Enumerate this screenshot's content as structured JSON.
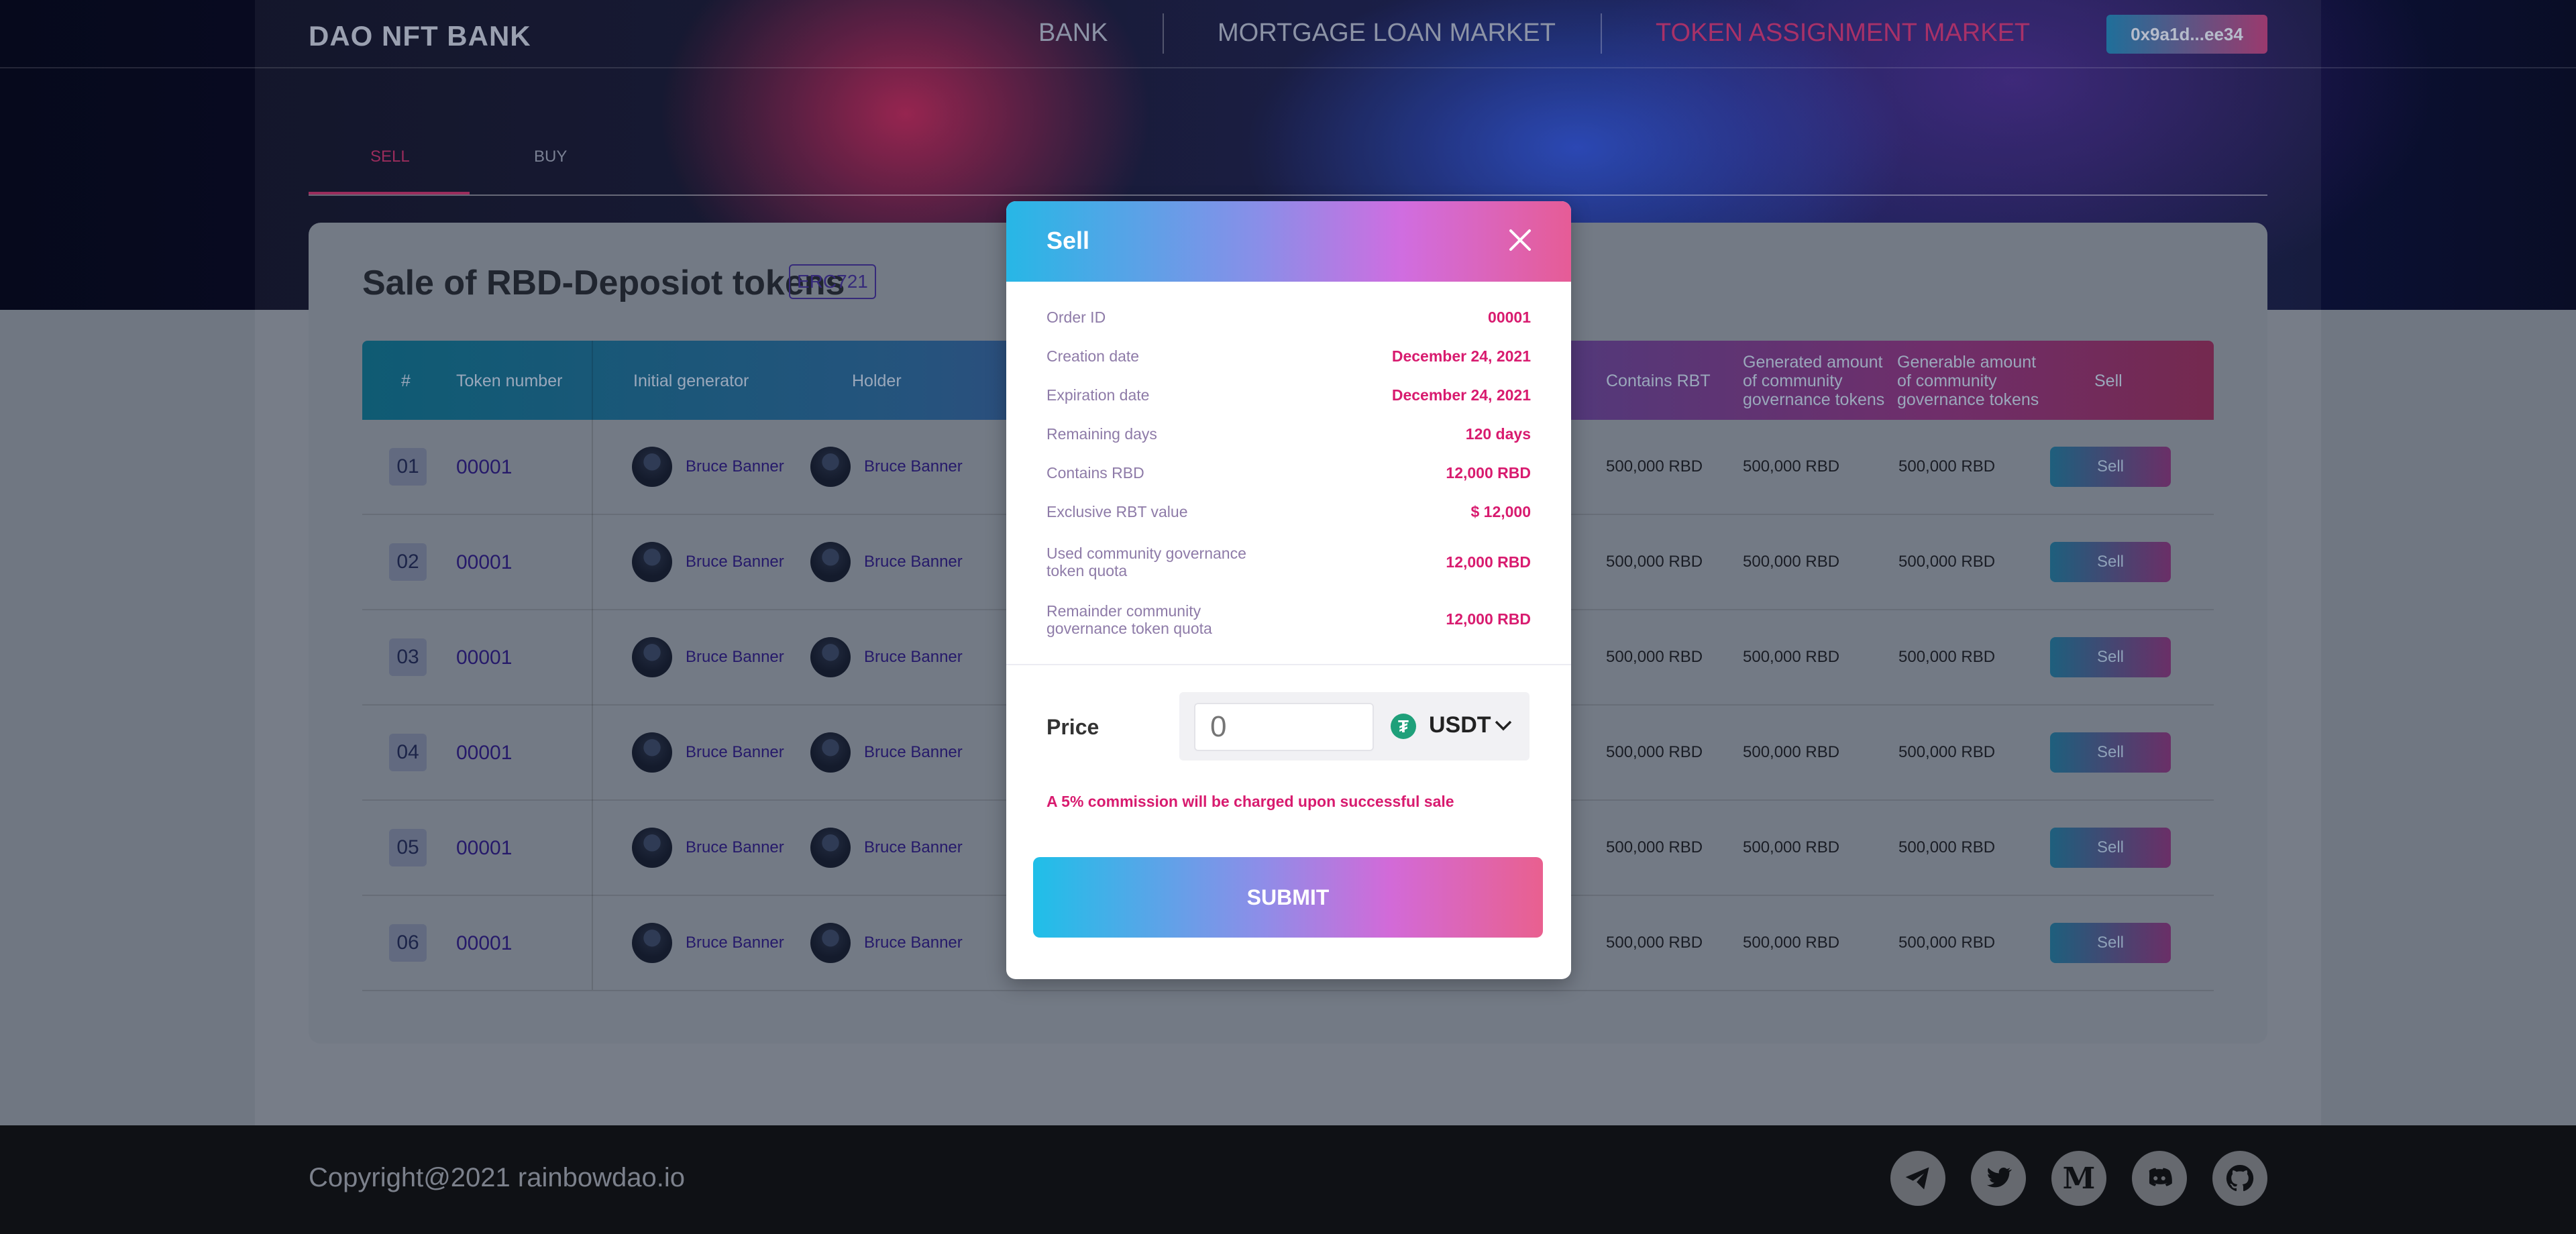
{
  "header": {
    "logo": "DAO NFT BANK",
    "nav": [
      "BANK",
      "MORTGAGE LOAN MARKET",
      "TOKEN ASSIGNMENT MARKET"
    ],
    "active_nav": "TOKEN ASSIGNMENT MARKET",
    "wallet": "0x9a1d...ee34"
  },
  "tabs": {
    "sell": "SELL",
    "buy": "BUY",
    "active": "SELL"
  },
  "card": {
    "title": "Sale of RBD-Deposiot tokens",
    "badge": "ERC721"
  },
  "table": {
    "columns": [
      "#",
      "Token number",
      "Initial generator",
      "Holder",
      "Contains RBT",
      "Generated amount of community governance tokens",
      "Generable amount of community governance tokens",
      "Sell"
    ],
    "rows": [
      {
        "num": "01",
        "token": "00001",
        "generator": "Bruce Banner",
        "holder": "Bruce Banner",
        "contains_rbt": "500,000 RBD",
        "generated": "500,000 RBD",
        "generable": "500,000 RBD",
        "action": "Sell"
      },
      {
        "num": "02",
        "token": "00001",
        "generator": "Bruce Banner",
        "holder": "Bruce Banner",
        "contains_rbt": "500,000 RBD",
        "generated": "500,000 RBD",
        "generable": "500,000 RBD",
        "action": "Sell"
      },
      {
        "num": "03",
        "token": "00001",
        "generator": "Bruce Banner",
        "holder": "Bruce Banner",
        "contains_rbt": "500,000 RBD",
        "generated": "500,000 RBD",
        "generable": "500,000 RBD",
        "action": "Sell"
      },
      {
        "num": "04",
        "token": "00001",
        "generator": "Bruce Banner",
        "holder": "Bruce Banner",
        "contains_rbt": "500,000 RBD",
        "generated": "500,000 RBD",
        "generable": "500,000 RBD",
        "action": "Sell"
      },
      {
        "num": "05",
        "token": "00001",
        "generator": "Bruce Banner",
        "holder": "Bruce Banner",
        "contains_rbt": "500,000 RBD",
        "generated": "500,000 RBD",
        "generable": "500,000 RBD",
        "action": "Sell"
      },
      {
        "num": "06",
        "token": "00001",
        "generator": "Bruce Banner",
        "holder": "Bruce Banner",
        "contains_rbt": "500,000 RBD",
        "generated": "500,000 RBD",
        "generable": "500,000 RBD",
        "action": "Sell"
      }
    ]
  },
  "modal": {
    "title": "Sell",
    "fields": [
      {
        "label": "Order ID",
        "value": "00001"
      },
      {
        "label": "Creation date",
        "value": "December 24, 2021"
      },
      {
        "label": "Expiration date",
        "value": "December 24, 2021"
      },
      {
        "label": "Remaining days",
        "value": "120 days"
      },
      {
        "label": "Contains RBD",
        "value": "12,000 RBD"
      },
      {
        "label": "Exclusive RBT value",
        "value": "$ 12,000"
      },
      {
        "label": "Used community governance token quota",
        "value": "12,000 RBD"
      },
      {
        "label": "Remainder community governance token quota",
        "value": "12,000 RBD"
      }
    ],
    "price_label": "Price",
    "price_placeholder": "0",
    "currency": "USDT",
    "currency_icon": "tether-icon",
    "note": "A 5% commission will be charged upon successful sale",
    "submit": "SUBMIT"
  },
  "footer": {
    "copyright": "Copyright@2021 rainbowdao.io",
    "social": [
      "telegram-icon",
      "twitter-icon",
      "medium-icon",
      "discord-icon",
      "github-icon"
    ]
  },
  "colors": {
    "accent_pink": "#d81b6f",
    "gradient_start": "#1fbfe8",
    "gradient_end": "#e9608f"
  }
}
